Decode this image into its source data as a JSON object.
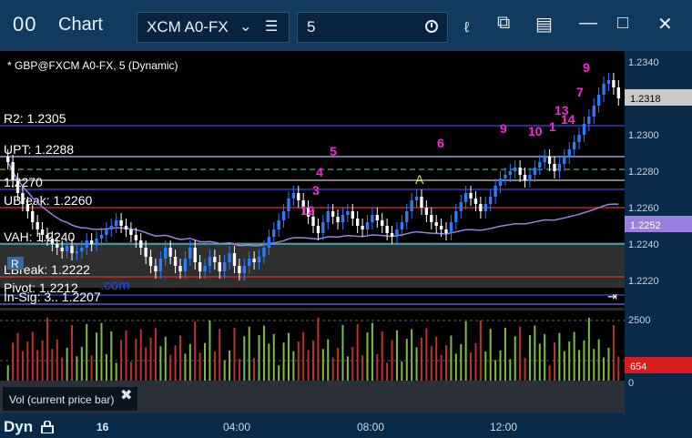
{
  "window": {
    "title": "Chart",
    "icon": "00",
    "symbol": "XCM A0-FX",
    "interval": "5",
    "pane_title": "* GBP@FXCM A0-FX, 5 (Dynamic)"
  },
  "icons": [
    "chart-app-icon",
    "chevron-down-icon",
    "menu-icon",
    "clock-icon",
    "draw-icon",
    "copy-icon",
    "template-icon",
    "minimize-icon",
    "maximize-icon",
    "close-icon",
    "lock-icon",
    "scroll-end-icon"
  ],
  "levels": [
    {
      "label": "R2: 1.2305",
      "price": 1.2305,
      "color": "#3a4ee8",
      "style": "solid"
    },
    {
      "label": "UPT: 1.2288",
      "price": 1.2288,
      "color": "#b0c0ff",
      "style": "solid"
    },
    {
      "label": "1.2270",
      "price": 1.227,
      "color": "#3a4ee8",
      "style": "solid"
    },
    {
      "label": "UBreak: 1.2260",
      "price": 1.226,
      "color": "#e03030",
      "style": "solid"
    },
    {
      "label": "VAH: 1.2240",
      "price": 1.224,
      "color": "#40d0e0",
      "style": "solid"
    },
    {
      "label": "LBreak: 1.2222",
      "price": 1.2222,
      "color": "#e03030",
      "style": "solid"
    },
    {
      "label": "Pivot: 1.2212",
      "price": 1.2212,
      "color": "#3a4ee8",
      "style": "solid"
    },
    {
      "label": "In-Sig: 3.. 1.2207",
      "price": 1.2207,
      "color": "#6070ff",
      "style": "solid"
    }
  ],
  "price_axis": {
    "ticks": [
      "1.2340",
      "1.2300",
      "1.2280",
      "1.2260",
      "1.2240",
      "1.2220"
    ],
    "last_price": "1.2318",
    "vwap_price": "1.2252"
  },
  "volume_axis": {
    "ticks": [
      "2500",
      "0"
    ],
    "current": "654"
  },
  "annotations": {
    "signal_letter": "A",
    "watermark": ".com",
    "r_box": "R"
  },
  "counts": [
    "5",
    "4",
    "3",
    "12",
    "6",
    "9",
    "10",
    "1",
    "13",
    "14",
    "7",
    "9"
  ],
  "footer": {
    "panel_label": "Vol (current price bar)",
    "mode": "Dyn",
    "date_label": "16",
    "times": [
      "04:00",
      "08:00",
      "12:00"
    ]
  },
  "colors": {
    "up": "#2a7cff",
    "down": "#ffffff",
    "volume_up": "#7dbf3a",
    "volume_down": "#c0302f",
    "count": "#ff22e0",
    "vwap": "#9b7fe0"
  },
  "chart_data": {
    "type": "candlestick",
    "title": "* GBP@FXCM A0-FX, 5 (Dynamic)",
    "ylim": [
      1.2205,
      1.2346
    ],
    "x_labels": [
      "16",
      "04:00",
      "08:00",
      "12:00"
    ],
    "closes": [
      1.2285,
      1.2275,
      1.2268,
      1.2262,
      1.2258,
      1.2252,
      1.2248,
      1.2245,
      1.2243,
      1.224,
      1.2238,
      1.2236,
      1.2239,
      1.2235,
      1.2236,
      1.2238,
      1.2242,
      1.224,
      1.2243,
      1.2245,
      1.2248,
      1.225,
      1.2253,
      1.225,
      1.2248,
      1.2245,
      1.2242,
      1.2238,
      1.2233,
      1.2228,
      1.2225,
      1.2232,
      1.2238,
      1.2233,
      1.2228,
      1.2225,
      1.2232,
      1.2238,
      1.223,
      1.2225,
      1.2228,
      1.2233,
      1.223,
      1.2225,
      1.223,
      1.2235,
      1.2228,
      1.2224,
      1.2228,
      1.2232,
      1.223,
      1.2233,
      1.2238,
      1.2244,
      1.2248,
      1.2253,
      1.2258,
      1.2265,
      1.2268,
      1.2264,
      1.226,
      1.2255,
      1.225,
      1.2246,
      1.2252,
      1.2258,
      1.2255,
      1.2252,
      1.2256,
      1.2258,
      1.2254,
      1.225,
      1.2248,
      1.2252,
      1.2256,
      1.2253,
      1.225,
      1.2246,
      1.2244,
      1.2248,
      1.2252,
      1.2258,
      1.2264,
      1.2266,
      1.226,
      1.2256,
      1.2252,
      1.225,
      1.2248,
      1.2246,
      1.2252,
      1.2258,
      1.2263,
      1.2268,
      1.2265,
      1.2262,
      1.2258,
      1.2262,
      1.2266,
      1.2272,
      1.2276,
      1.2278,
      1.228,
      1.2282,
      1.2278,
      1.2275,
      1.2278,
      1.2282,
      1.2285,
      1.2288,
      1.2284,
      1.228,
      1.2284,
      1.2288,
      1.2292,
      1.2296,
      1.23,
      1.2306,
      1.231,
      1.2316,
      1.2322,
      1.2328,
      1.233,
      1.2326,
      1.232
    ],
    "volume_max": 3000
  }
}
